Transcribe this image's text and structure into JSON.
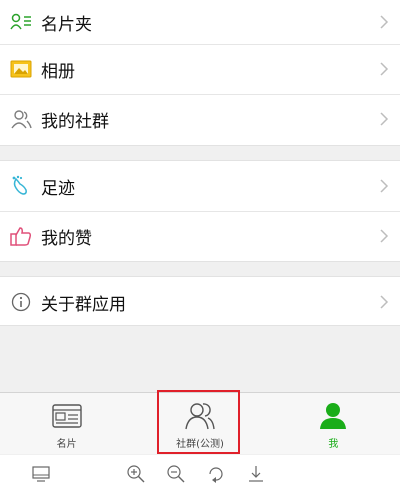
{
  "menu": {
    "group1": [
      {
        "label": "名片夹",
        "icon": "contact-card-icon"
      },
      {
        "label": "相册",
        "icon": "photo-album-icon"
      },
      {
        "label": "我的社群",
        "icon": "community-icon"
      }
    ],
    "group2": [
      {
        "label": "足迹",
        "icon": "footprint-icon"
      },
      {
        "label": "我的赞",
        "icon": "thumbs-up-icon"
      }
    ],
    "group3": [
      {
        "label": "关于群应用",
        "icon": "info-icon"
      }
    ]
  },
  "tabbar": {
    "tabs": [
      {
        "label": "名片",
        "icon": "card-icon",
        "active": false
      },
      {
        "label": "社群(公测)",
        "icon": "people-icon",
        "active": false,
        "highlighted": true
      },
      {
        "label": "我",
        "icon": "profile-icon",
        "active": true
      }
    ]
  },
  "toolbar": {
    "tools": [
      "monitor-icon",
      "zoom-in-icon",
      "zoom-out-icon",
      "rotate-icon",
      "download-icon"
    ]
  },
  "colors": {
    "accent_green": "#1aad19",
    "highlight_red": "#e0202a",
    "background": "#f0f0f0"
  }
}
